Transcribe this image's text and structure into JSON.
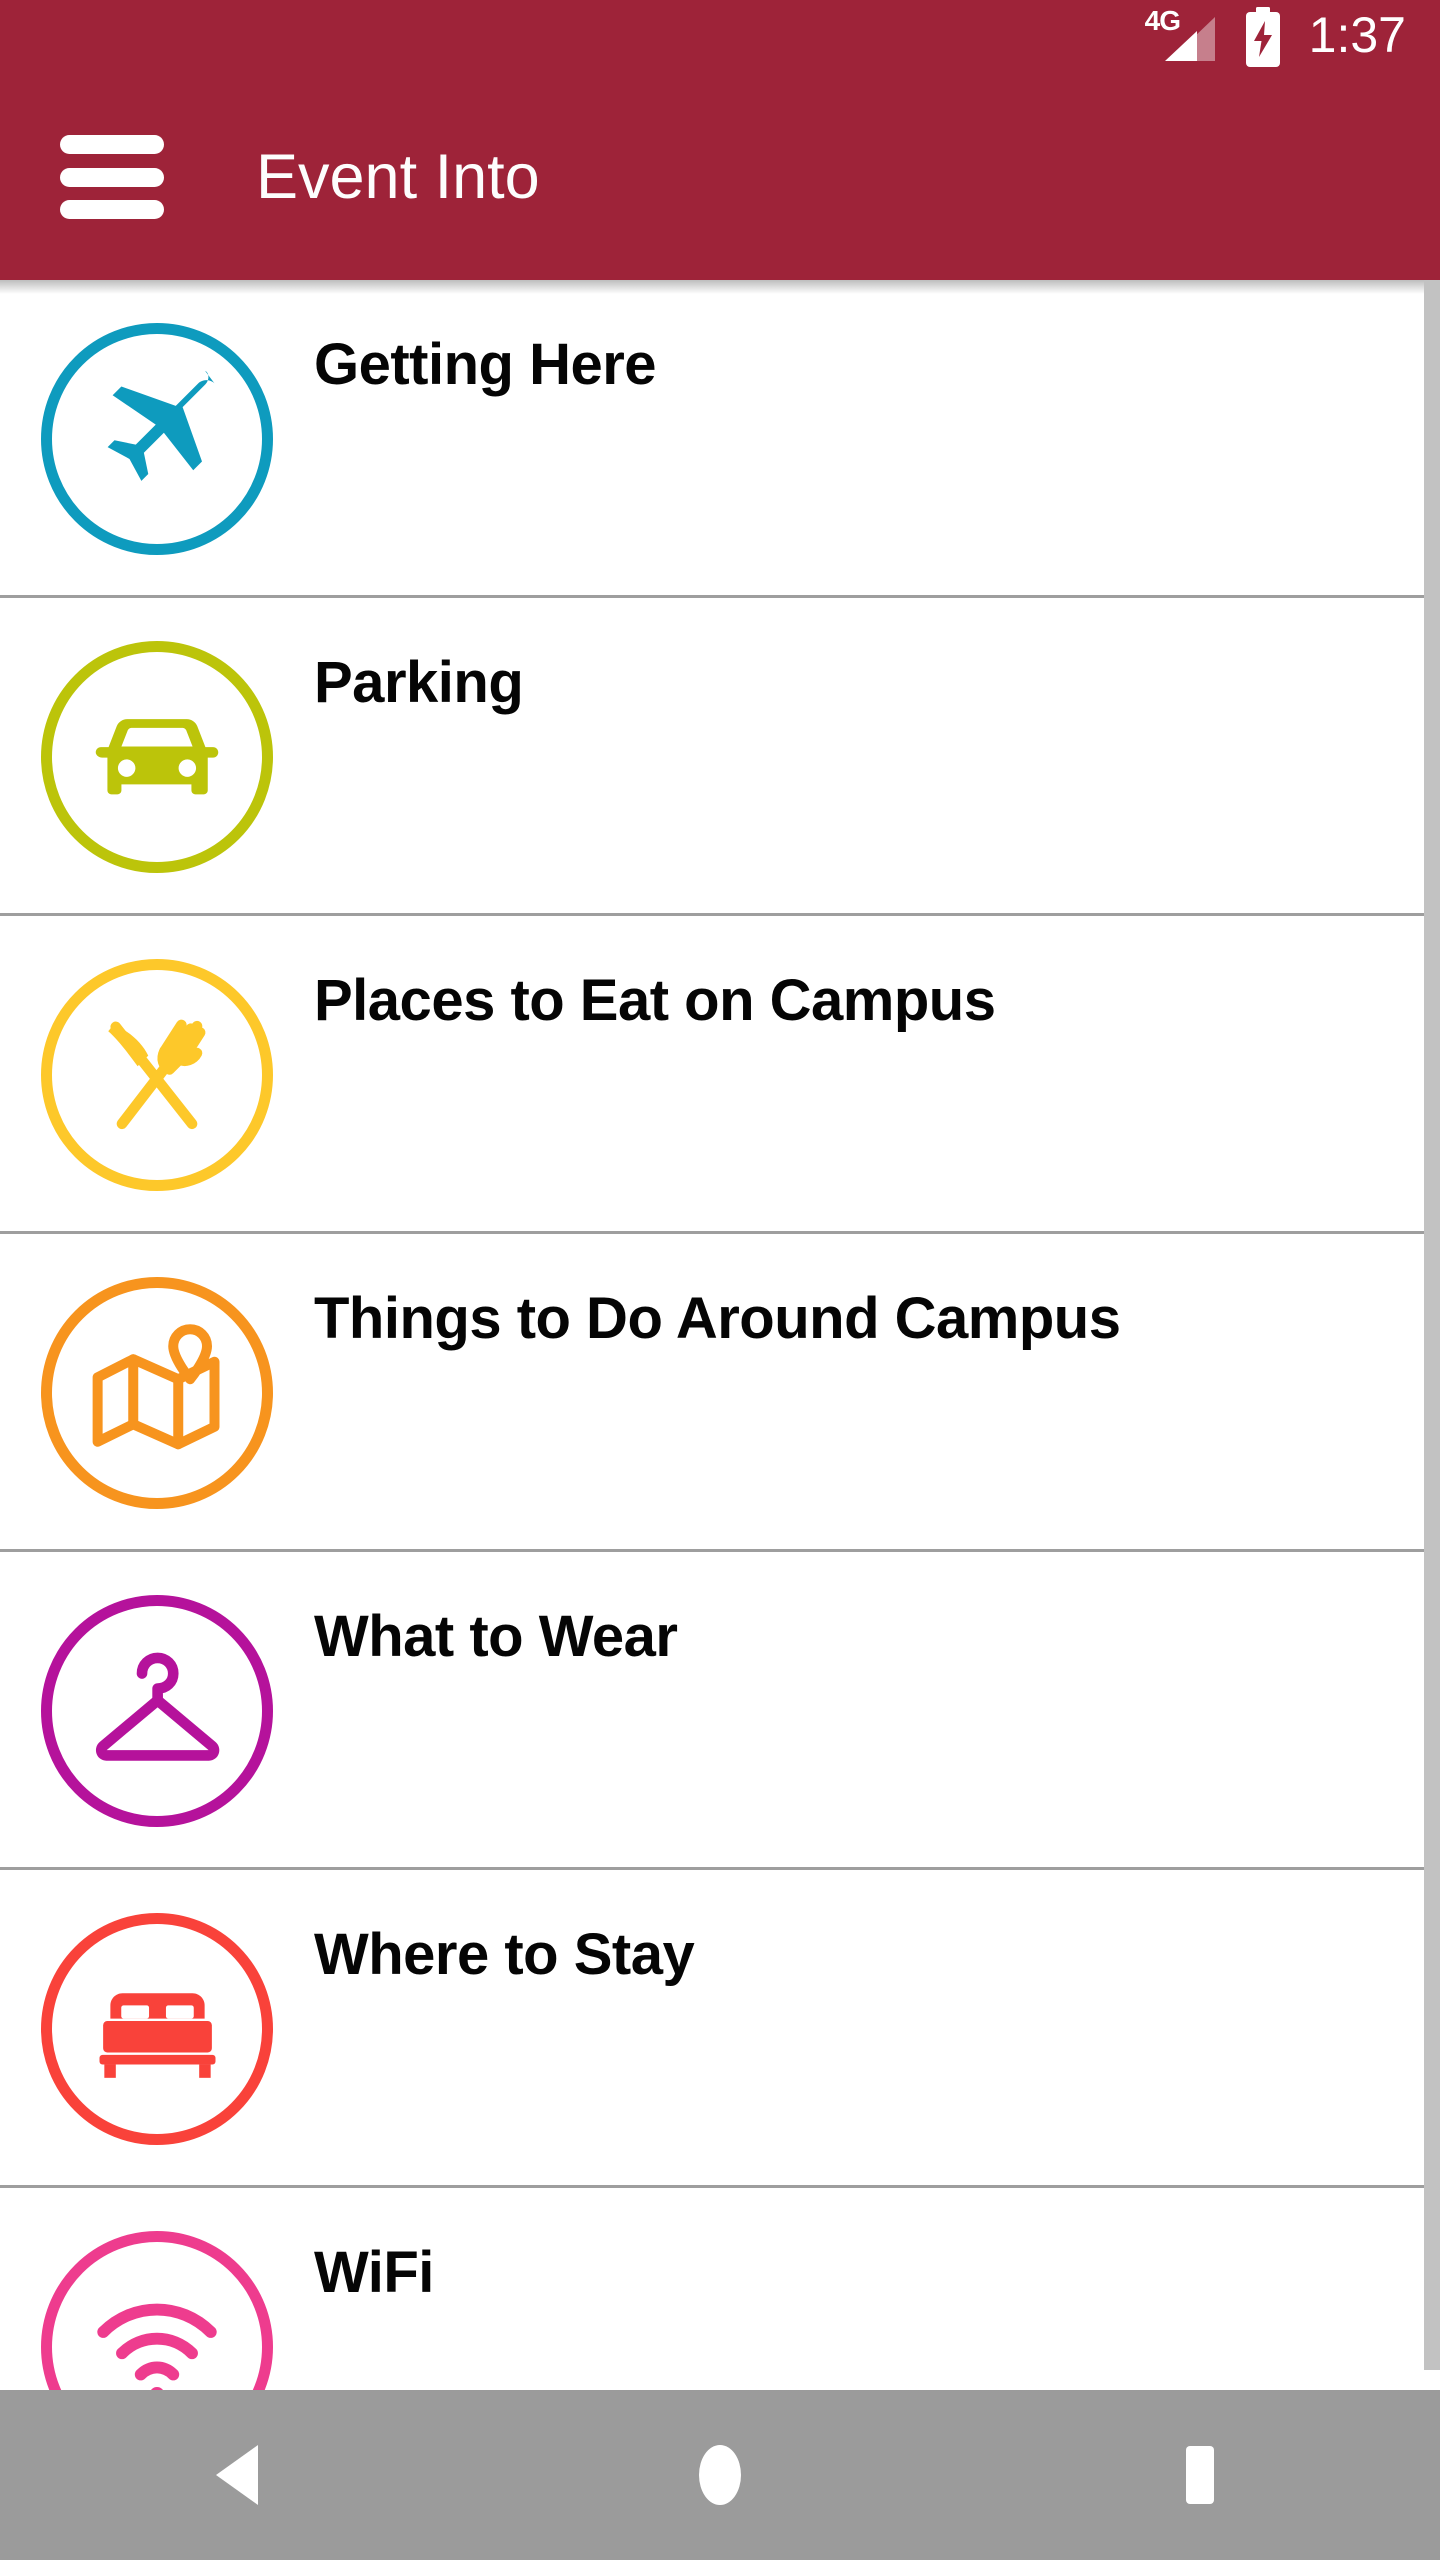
{
  "status_bar": {
    "network_label": "4G",
    "signal_icon": "signal-bars-icon",
    "battery_icon": "battery-charging-icon",
    "time": "1:37"
  },
  "app_bar": {
    "menu_icon": "hamburger-menu-icon",
    "title": "Event Into",
    "background_color": "#9E2339"
  },
  "list": {
    "items": [
      {
        "label": "Getting Here",
        "icon": "airplane-icon",
        "color": "#0E9BBE"
      },
      {
        "label": "Parking",
        "icon": "car-icon",
        "color": "#BCC40A"
      },
      {
        "label": "Places to Eat on Campus",
        "icon": "fork-knife-icon",
        "color": "#FDC82A"
      },
      {
        "label": "Things to Do Around Campus",
        "icon": "map-pin-icon",
        "color": "#F7941E"
      },
      {
        "label": "What to Wear",
        "icon": "clothes-hanger-icon",
        "color": "#B5129B"
      },
      {
        "label": "Where to Stay",
        "icon": "bed-icon",
        "color": "#F9423A"
      },
      {
        "label": "WiFi",
        "icon": "wifi-icon",
        "color": "#EE3C8E"
      }
    ]
  },
  "nav_bar": {
    "back_label": "back-button",
    "home_label": "home-button",
    "recents_label": "recents-button",
    "background_color": "#9B9B9B"
  }
}
